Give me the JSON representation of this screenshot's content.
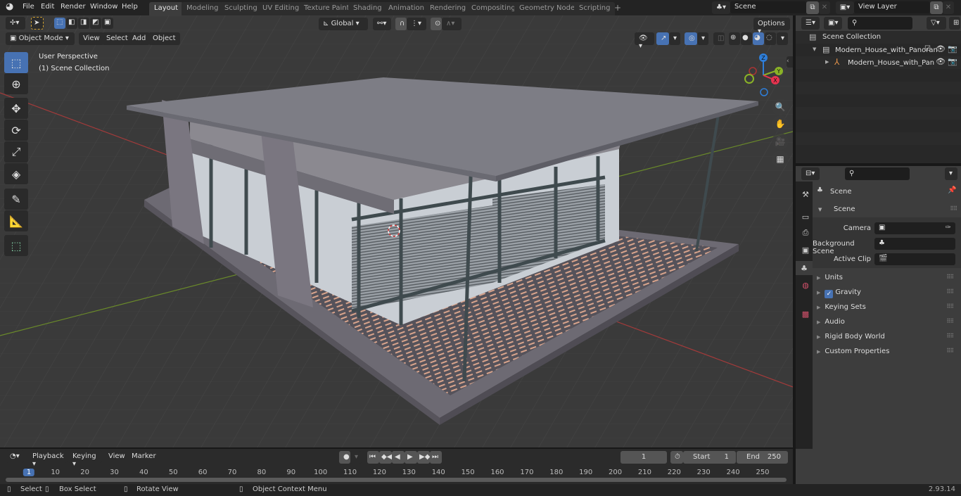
{
  "topbar": {
    "menu": [
      "File",
      "Edit",
      "Render",
      "Window",
      "Help"
    ],
    "workspaces": [
      "Layout",
      "Modeling",
      "Sculpting",
      "UV Editing",
      "Texture Paint",
      "Shading",
      "Animation",
      "Rendering",
      "Compositing",
      "Geometry Nodes",
      "Scripting"
    ],
    "active_workspace": "Layout",
    "add_tab": "+",
    "scene": "Scene",
    "view_layer": "View Layer"
  },
  "viewport": {
    "mode": "Object Mode",
    "menus": [
      "View",
      "Select",
      "Add",
      "Object"
    ],
    "orientation": "Global",
    "options": "Options",
    "overlay_title": "User Perspective",
    "overlay_subtitle": "(1) Scene Collection",
    "gizmo": {
      "x": "X",
      "y": "Y",
      "z": "Z"
    },
    "colors": {
      "accent": "#4772b3",
      "x_axis": "#e8334f",
      "y_axis": "#8ab227",
      "z_axis": "#2e7ed9",
      "floor_wood": "#d9a48c",
      "frame": "#3f4a4e",
      "wall": "#d3d7dd",
      "slab": "#7d7d85"
    }
  },
  "outliner": {
    "root": "Scene Collection",
    "items": [
      {
        "label": "Modern_House_with_Panoran",
        "level": 1,
        "type": "collection",
        "checked": true
      },
      {
        "label": "Modern_House_with_Pan",
        "level": 2,
        "type": "empty"
      }
    ]
  },
  "properties": {
    "context": "Scene",
    "panel": "Scene",
    "fields": [
      {
        "label": "Camera",
        "value": ""
      },
      {
        "label": "Background Scene",
        "value": ""
      },
      {
        "label": "Active Clip",
        "value": ""
      }
    ],
    "sections": [
      "Units",
      "Gravity",
      "Keying Sets",
      "Audio",
      "Rigid Body World",
      "Custom Properties"
    ],
    "gravity_checked": true
  },
  "timeline": {
    "menus": [
      "Playback",
      "Keying",
      "View",
      "Marker"
    ],
    "current_frame": "1",
    "start_label": "Start",
    "start": "1",
    "end_label": "End",
    "end": "250",
    "ticks": [
      "1",
      "10",
      "20",
      "30",
      "40",
      "50",
      "60",
      "70",
      "80",
      "90",
      "100",
      "110",
      "120",
      "130",
      "140",
      "150",
      "160",
      "170",
      "180",
      "190",
      "200",
      "210",
      "220",
      "230",
      "240",
      "250"
    ]
  },
  "statusbar": {
    "select": "Select",
    "box_select": "Box Select",
    "rotate": "Rotate View",
    "context_menu": "Object Context Menu",
    "version": "2.93.14"
  }
}
